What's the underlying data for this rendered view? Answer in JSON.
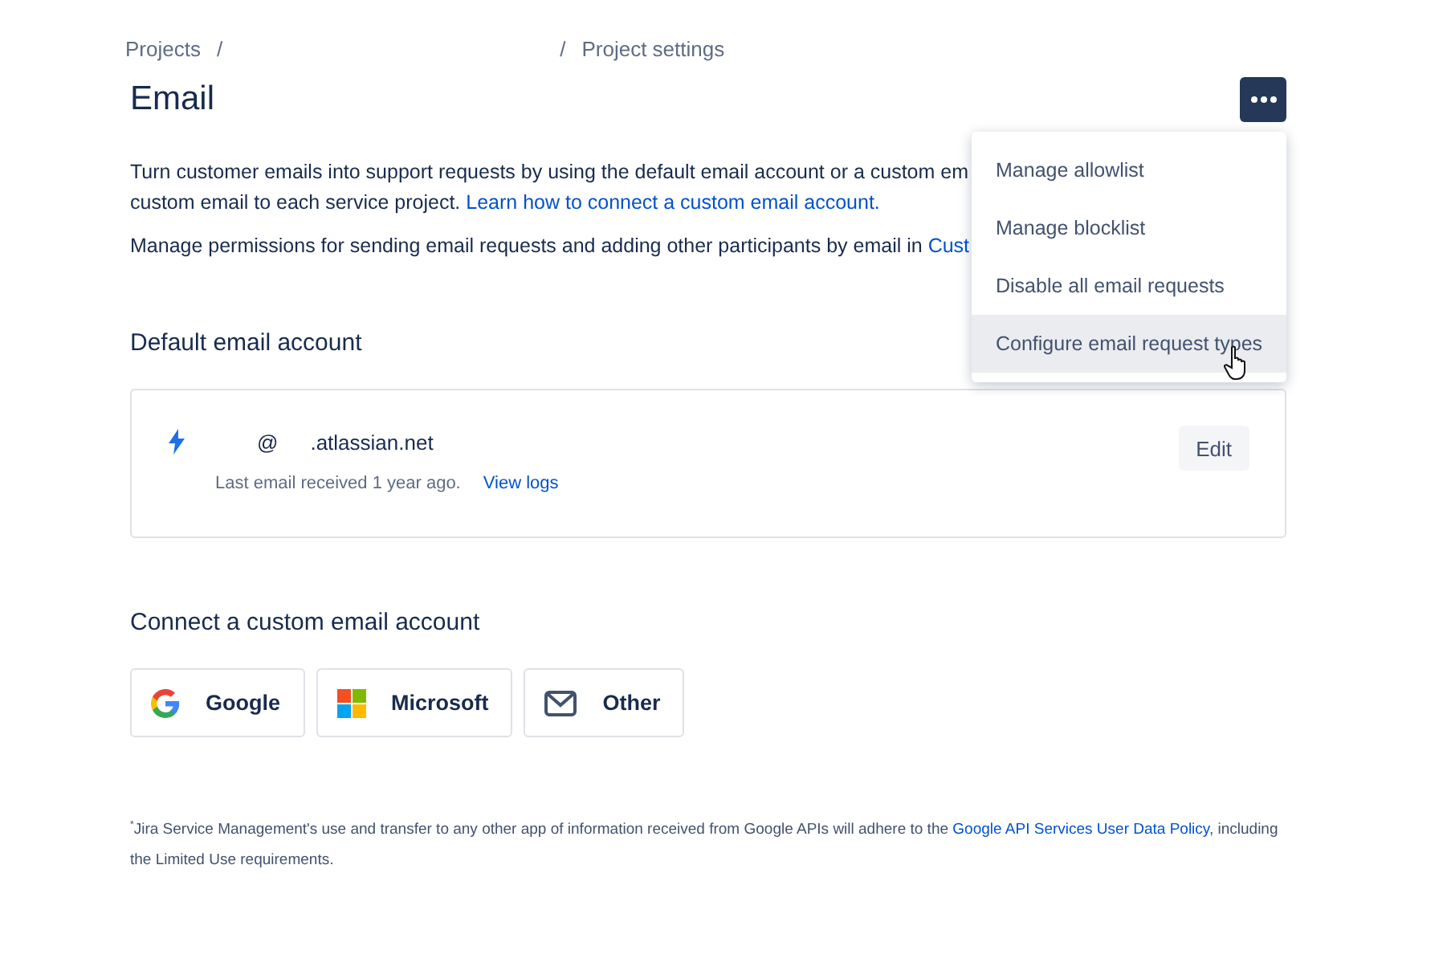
{
  "breadcrumbs": [
    "Projects",
    "/",
    "/",
    "Project settings"
  ],
  "title": "Email",
  "intro": {
    "lines": [
      "Turn customer emails into support requests by using the default email account or a custom em",
      "custom email to each service project."
    ],
    "link": "Learn how to connect a custom email account."
  },
  "permissions": {
    "text": "Manage permissions for sending email requests and adding other participants by email in",
    "link": "Cust"
  },
  "menu": {
    "open": true,
    "items": [
      {
        "label": "Manage allowlist",
        "selected": false
      },
      {
        "label": "Manage blocklist",
        "selected": false
      },
      {
        "label": "Disable all email requests",
        "selected": false
      },
      {
        "label": "Configure email request types",
        "selected": true
      }
    ]
  },
  "default_account": {
    "heading": "Default email account",
    "at": "@",
    "domain": ".atlassian.net",
    "last_received": "Last email received 1 year ago.",
    "logs_link": "View logs",
    "edit": "Edit"
  },
  "custom_account": {
    "heading": "Connect a custom email account",
    "providers": [
      {
        "kind": "google",
        "label": "Google"
      },
      {
        "kind": "microsoft",
        "label": "Microsoft"
      },
      {
        "kind": "other",
        "label": "Other"
      }
    ]
  },
  "footnote": {
    "mark": "*",
    "text": "Jira Service Management's use and transfer to any other app of information received from Google APIs will adhere to the",
    "link": "Google API Services User Data Policy",
    "rest": ", including the Limited Use requirements."
  }
}
